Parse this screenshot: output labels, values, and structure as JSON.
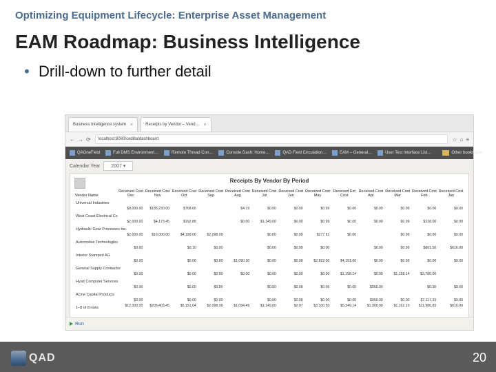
{
  "small_title": "Optimizing Equipment Lifecycle: Enterprise Asset Management",
  "big_title": "EAM Roadmap: Business Intelligence",
  "bullet_text": "Drill-down to further detail",
  "browser": {
    "tab1": "Business Intelligence system",
    "tab2": "Receipts by Vendor – Vend…",
    "url": "localhost:8080/cedilla/dashboard",
    "bookmarks": {
      "b1": "QAOneField",
      "b2": "Full DMS Environment…",
      "b3": "Remote Thread Con…",
      "b4": "Console Dash: Home…",
      "b5": "QAD Field Circulation…",
      "b6": "EAM – General…",
      "b7": "User Test Interface List…",
      "bOther": "Other bookmarks"
    }
  },
  "filter": {
    "label": "Calendar Year",
    "value": "2007"
  },
  "report": {
    "title": "Receipts By Vendor By Period",
    "cols": [
      "Vendor Name",
      "Received Cost Dec",
      "Received Cost Nov",
      "Received Cost Oct",
      "Received Cost Sep",
      "Received Cost Aug",
      "Received Cost Jul",
      "Received Cost Jun",
      "Received Cost May",
      "Received Ext Cost",
      "Received Cost Apr",
      "Received Cost Mar",
      "Received Cost Feb",
      "Received Cost Jan"
    ],
    "vendors": [
      {
        "name": "Universal Industries",
        "vals": [
          "$8,000.00",
          "$185,230.00",
          "$768.66",
          "",
          "$4.19",
          "$0.00",
          "$0.00",
          "$0.99",
          "$0.00",
          "$0.00",
          "$0.99",
          "$0.00",
          "$0.00"
        ]
      },
      {
        "name": "West Coast Electrical Co",
        "vals": [
          "$2,000.00",
          "$4,173.45",
          "$192.88",
          "",
          "$0.00",
          "$1,149.00",
          "$0.00",
          "$0.99",
          "$0.00",
          "$0.00",
          "$0.99",
          "$228.00",
          "$0.00"
        ]
      },
      {
        "name": "Hydraulic Gear Processes Inc.",
        "vals": [
          "$2,000.00",
          "$16,000.00",
          "$4,190.00",
          "$2,098.09",
          "",
          "$0.00",
          "$0.99",
          "$277.51",
          "$0.00",
          "",
          "$0.99",
          "$0.00",
          "$0.00"
        ]
      },
      {
        "name": "Automotive Technologies",
        "vals": [
          "$0.00",
          "",
          "$0.10",
          "$0.00",
          "",
          "$0.00",
          "$0.99",
          "$0.00",
          "",
          "$0.00",
          "$0.99",
          "$861.50",
          "$616.00"
        ]
      },
      {
        "name": "Interior Stamped AG",
        "vals": [
          "$0.00",
          "",
          "$0.00",
          "$0.00",
          "$1,090.30",
          "$0.00",
          "$0.00",
          "$2,822.00",
          "$4,191.00",
          "$0.00",
          "$0.99",
          "$0.00",
          "$0.00"
        ]
      },
      {
        "name": "General Supply Contractor",
        "vals": [
          "$0.00",
          "",
          "$0.00",
          "$0.00",
          "$0.00",
          "$0.00",
          "$0.00",
          "$0.00",
          "$1,158.14",
          "$0.00",
          "$1,158.14",
          "$3,780.00",
          ""
        ]
      },
      {
        "name": "Hyatt Computer Services",
        "vals": [
          "$0.00",
          "",
          "$0.00",
          "$0.00",
          "",
          "$0.00",
          "$0.00",
          "$0.00",
          "$0.00",
          "$950.00",
          "",
          "$0.00",
          "$0.00"
        ]
      },
      {
        "name": "Acme Capital Products",
        "vals": [
          "$0.00",
          "",
          "$0.00",
          "$0.00",
          "",
          "$0.00",
          "$0.00",
          "$0.00",
          "$0.00",
          "$950.00",
          "$0.00",
          "$7,117.33",
          "$0.00"
        ]
      }
    ],
    "total_note": "1–8 of 8 rows",
    "totals": [
      "$12,000.00",
      "$205,403.45",
      "$5,151.64",
      "$2,098.09",
      "$1,094.49",
      "$1,149.00",
      "$2.97",
      "$3,100.50",
      "$5,349.14",
      "$1,900.00",
      "$1,162.10",
      "$11,986.83",
      "$616.00"
    ]
  },
  "run_label": "Run",
  "brand": "QAD",
  "page_number": "20"
}
